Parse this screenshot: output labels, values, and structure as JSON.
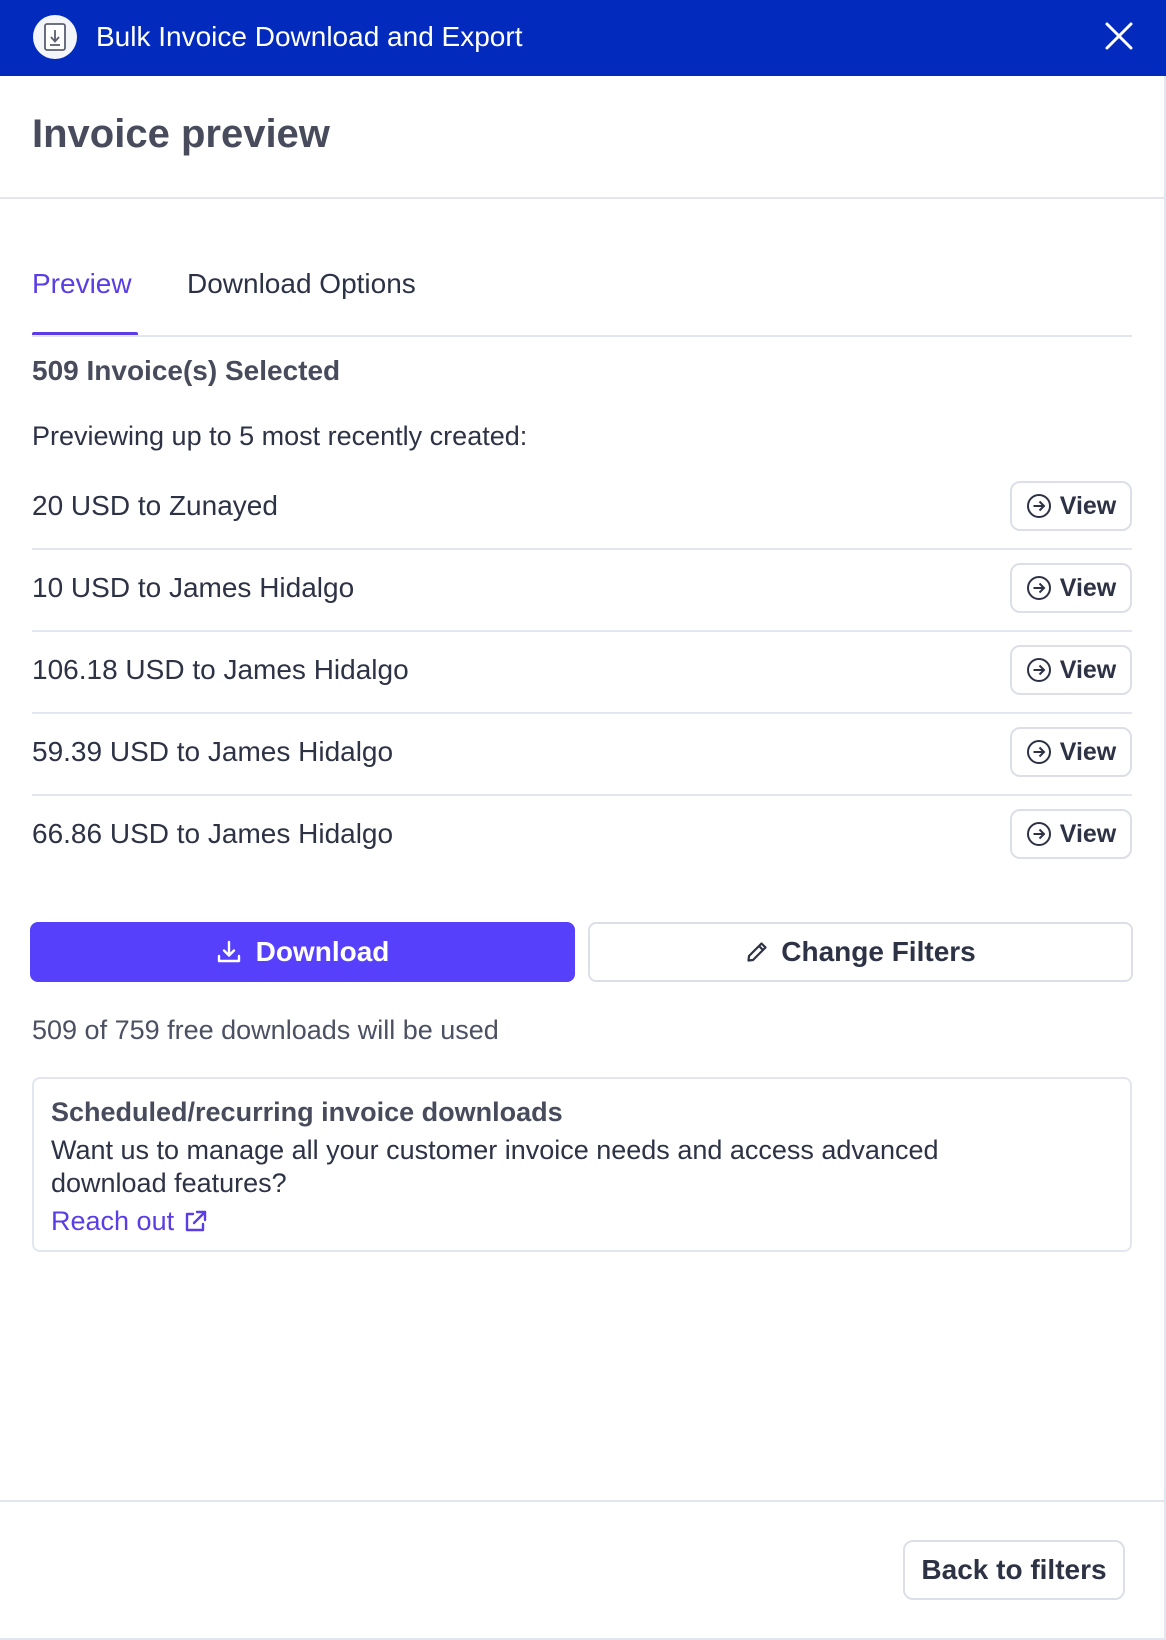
{
  "window": {
    "title": "Bulk Invoice Download and Export",
    "icon": "invoice-download-icon",
    "close_icon": "close-icon"
  },
  "header": {
    "title": "Invoice preview"
  },
  "tabs": [
    {
      "label": "Preview",
      "active": true
    },
    {
      "label": "Download Options",
      "active": false
    }
  ],
  "summary": {
    "selected": "509 Invoice(s) Selected",
    "preview_note": "Previewing up to 5 most recently created:"
  },
  "invoices": [
    {
      "text": "20 USD to Zunayed",
      "action": "View"
    },
    {
      "text": "10 USD to James Hidalgo",
      "action": "View"
    },
    {
      "text": "106.18 USD to James Hidalgo",
      "action": "View"
    },
    {
      "text": "59.39 USD to James Hidalgo",
      "action": "View"
    },
    {
      "text": "66.86 USD to James Hidalgo",
      "action": "View"
    }
  ],
  "actions": {
    "download_label": "Download",
    "change_filters_label": "Change Filters"
  },
  "usage_note": "509 of 759 free downloads will be used",
  "callout": {
    "title": "Scheduled/recurring invoice downloads",
    "body": "Want us to manage all your customer invoice needs and access advanced download features?",
    "link_label": "Reach out"
  },
  "footer": {
    "back_label": "Back to filters"
  },
  "colors": {
    "titlebar": "#022bbd",
    "accent": "#5b3de6",
    "primary_button": "#5640fb",
    "border": "#e3e6ee"
  }
}
